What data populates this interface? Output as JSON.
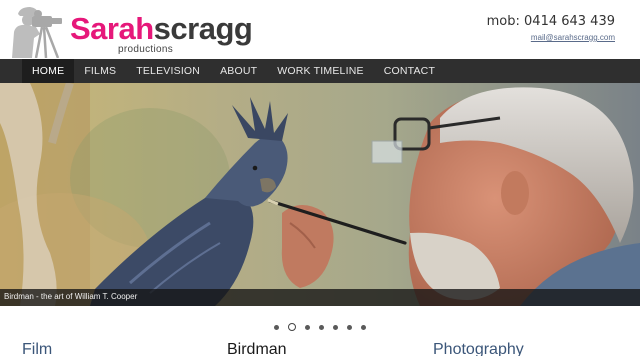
{
  "brand": {
    "name_part1": "Sarah",
    "name_part2": "scragg",
    "tagline": "productions",
    "logo_icon": "cameraman-silhouette-icon",
    "pink": "#e6187a",
    "dark": "#3a3a3a"
  },
  "contact": {
    "phone": "mob: 0414 643 439",
    "email": "mail@sarahscragg.com"
  },
  "nav": {
    "items": [
      {
        "label": "HOME",
        "active": true
      },
      {
        "label": "FILMS",
        "active": false
      },
      {
        "label": "TELEVISION",
        "active": false
      },
      {
        "label": "ABOUT",
        "active": false
      },
      {
        "label": "WORK TIMELINE",
        "active": false
      },
      {
        "label": "CONTACT",
        "active": false
      }
    ],
    "background": "#2f2f2f"
  },
  "slider": {
    "caption": "Birdman - the art of William T. Cooper",
    "slide_count": 7,
    "active_index": 1
  },
  "columns": [
    {
      "heading": "Film"
    },
    {
      "heading": "Birdman"
    },
    {
      "heading": "Photography"
    }
  ]
}
